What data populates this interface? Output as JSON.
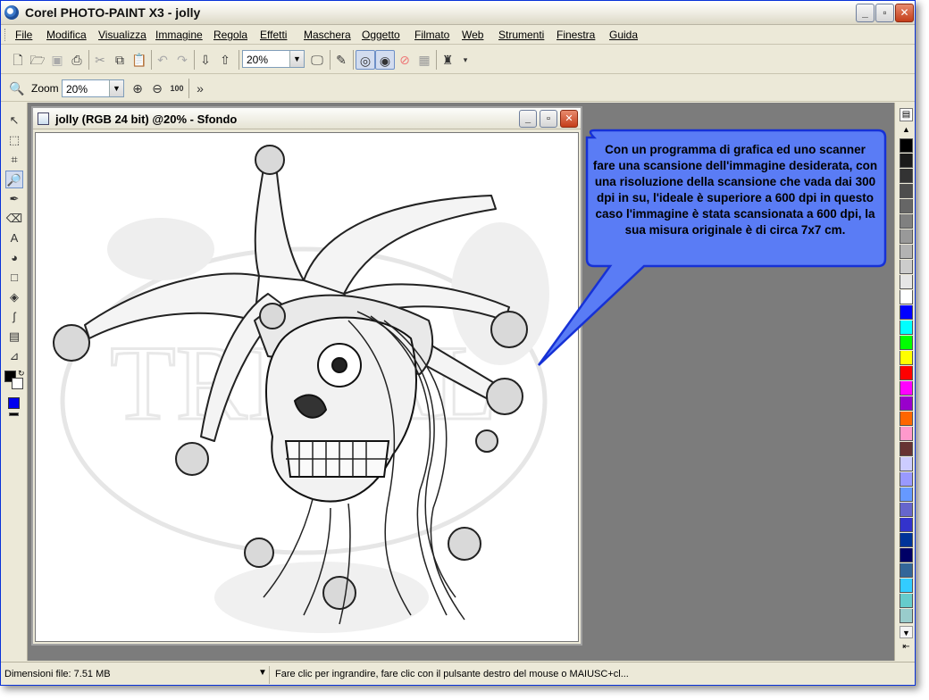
{
  "window": {
    "title": "Corel PHOTO-PAINT X3 - jolly",
    "controls": {
      "minimize": "_",
      "maximize": "▫",
      "close": "✕"
    }
  },
  "menu": [
    "File",
    "Modifica",
    "Visualizza",
    "Immagine",
    "Regola",
    "Effetti",
    "Maschera",
    "Oggetto",
    "Filmato",
    "Web",
    "Strumenti",
    "Finestra",
    "Guida"
  ],
  "toolbar1": {
    "zoom_value": "20%",
    "icons": [
      "new-icon",
      "open-icon",
      "save-icon",
      "print-icon",
      "cut-icon",
      "copy-icon",
      "paste-icon",
      "undo-icon",
      "redo-icon",
      "import-icon",
      "export-icon",
      "zoom-combo",
      "fullscreen-icon",
      "corel-icon",
      "mask-icon",
      "mask-marquee-icon",
      "mask-overlay-icon",
      "object-icon",
      "launcher-icon"
    ]
  },
  "toolbar2": {
    "zoom_label": "Zoom",
    "zoom_value": "20%",
    "zoom_in": "⊕",
    "zoom_out": "⊖",
    "zoom_100": "100"
  },
  "document": {
    "title": "jolly (RGB 24 bit) @20% - Sfondo",
    "watermark": "TRIBAL"
  },
  "callout": {
    "text": "Con un programma di grafica ed uno scanner fare una scansione dell'immagine desiderata, con una risoluzione della scansione che vada dai 300 dpi in su, l'ideale è superiore a 600 dpi in questo caso l'immagine è stata scansionata a 600 dpi, la sua misura originale è di circa 7x7 cm.",
    "fill": "#5a7cf5",
    "border": "#1631d6"
  },
  "palette": [
    "#000000",
    "#1a1a1a",
    "#333333",
    "#4d4d4d",
    "#666666",
    "#808080",
    "#999999",
    "#b3b3b3",
    "#cccccc",
    "#e6e6e6",
    "#ffffff",
    "#0000ff",
    "#00ffff",
    "#00ff00",
    "#ffff00",
    "#ff0000",
    "#ff00ff",
    "#9900cc",
    "#ff6600",
    "#ff99cc",
    "#663333",
    "#ccccff",
    "#9999ff",
    "#6699ff",
    "#6666cc",
    "#3333cc",
    "#003399",
    "#000066",
    "#336699",
    "#33ccff",
    "#66cccc",
    "#99cccc"
  ],
  "status": {
    "file_size": "Dimensioni file: 7.51 MB",
    "hint": "Fare clic per ingrandire, fare clic con il pulsante destro del mouse o MAIUSC+cl..."
  }
}
